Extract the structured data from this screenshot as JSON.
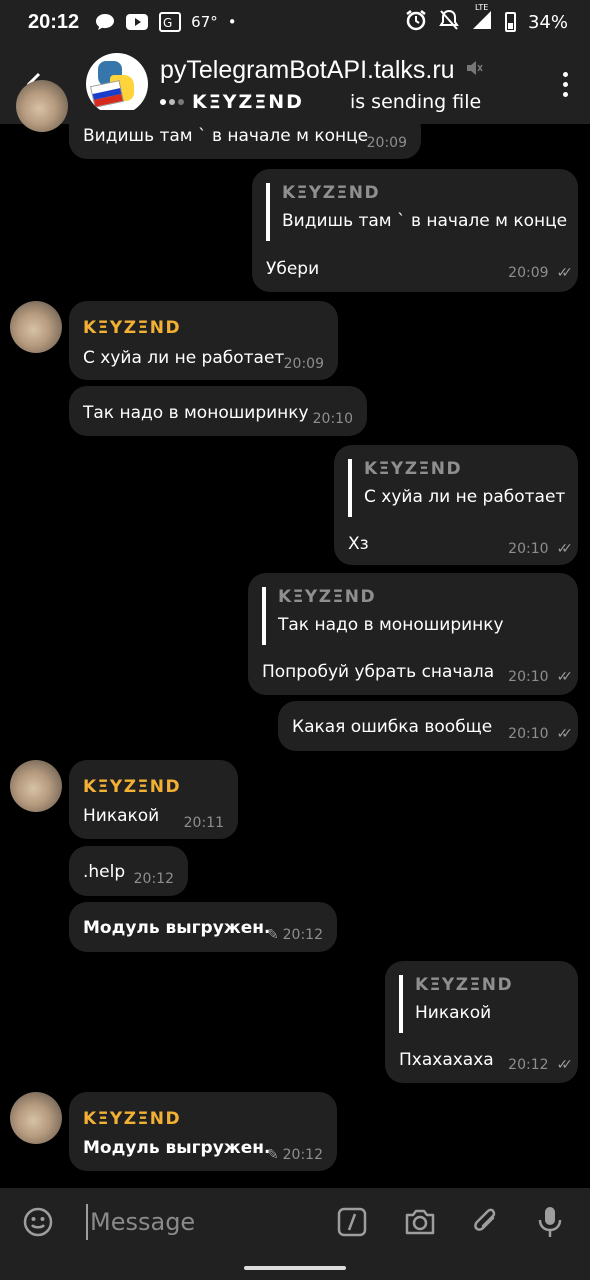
{
  "statusbar": {
    "time": "20:12",
    "temp": "67°",
    "network": "LTE",
    "battery": "34%"
  },
  "header": {
    "title": "pyTelegramBotAPI.talks.ru",
    "status_name": "KΞYZΞND",
    "status_text": "is sending file"
  },
  "messages": [
    {
      "text": "Видишь там ` в начале м конце",
      "time": "20:09"
    },
    {
      "quote_name": "KΞYZΞND",
      "quote_text": "Видишь там ` в начале м конце",
      "text": "Убери",
      "time": "20:09"
    },
    {
      "sender": "KΞYZΞND",
      "text": "С хуйа ли не работает",
      "time": "20:09"
    },
    {
      "text": "Так надо в моноширинку",
      "time": "20:10"
    },
    {
      "quote_name": "KΞYZΞND",
      "quote_text": "С хуйа ли не работает",
      "text": "Хз",
      "time": "20:10"
    },
    {
      "quote_name": "KΞYZΞND",
      "quote_text": "Так надо в моноширинку",
      "text": "Попробуй убрать сначала",
      "time": "20:10"
    },
    {
      "text": "Какая ошибка вообще",
      "time": "20:10"
    },
    {
      "sender": "KΞYZΞND",
      "text": "Никакой",
      "time": "20:11"
    },
    {
      "text": ".help",
      "time": "20:12"
    },
    {
      "text": "Модуль выгружен.",
      "time": "20:12"
    },
    {
      "quote_name": "KΞYZΞND",
      "quote_text": "Никакой",
      "text": "Пхахахаха",
      "time": "20:12"
    },
    {
      "sender": "KΞYZΞND",
      "text": "Модуль выгружен.",
      "time": "20:12"
    }
  ],
  "input": {
    "placeholder": "Message"
  },
  "icons": {
    "back": "arrow-left-icon",
    "mute": "muted-speaker-icon",
    "menu": "vertical-dots-icon",
    "emoji": "emoji-icon",
    "commands": "slash-command-icon",
    "camera": "camera-icon",
    "attach": "paperclip-icon",
    "mic": "microphone-icon"
  }
}
